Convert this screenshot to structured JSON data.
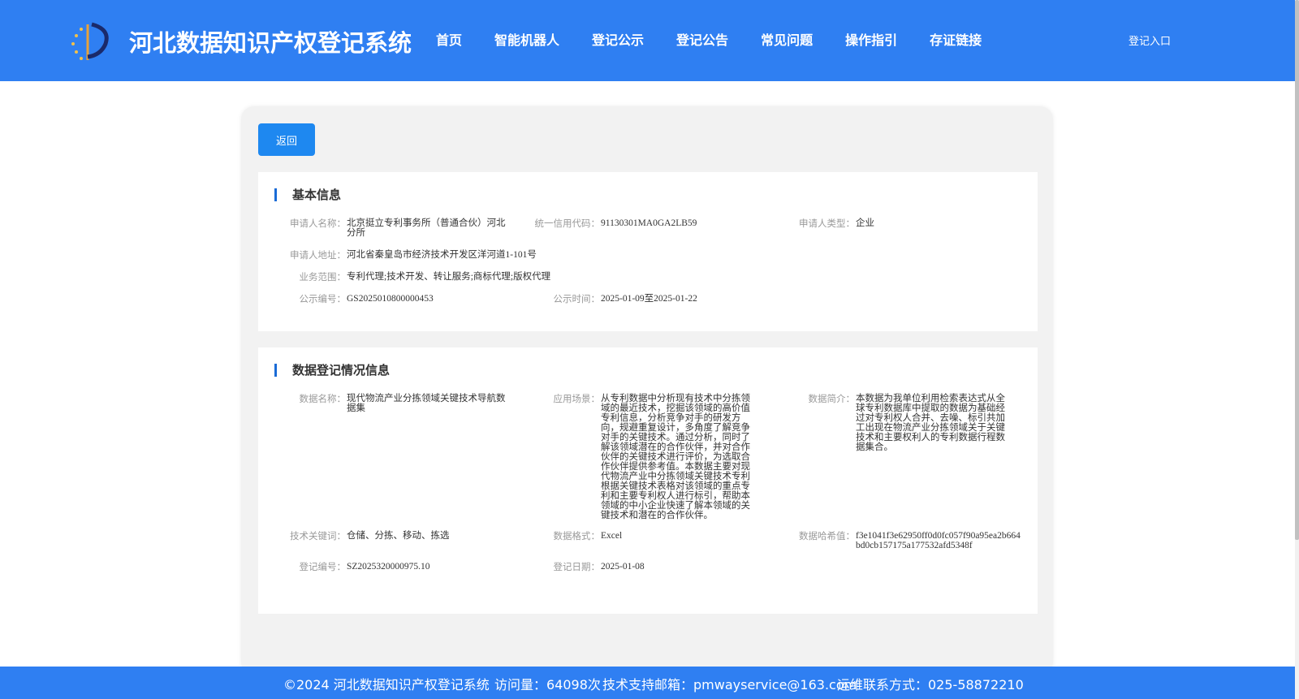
{
  "header": {
    "title": "河北数据知识产权登记系统",
    "nav": [
      "首页",
      "智能机器人",
      "登记公示",
      "登记公告",
      "常见问题",
      "操作指引",
      "存证链接"
    ],
    "login": "登记入口"
  },
  "back_button": "返回",
  "basic": {
    "title": "基本信息",
    "applicant_name_label": "申请人名称：",
    "applicant_name": "北京挺立专利事务所（普通合伙）河北分所",
    "credit_code_label": "统一信用代码：",
    "credit_code": "91130301MA0GA2LB59",
    "applicant_type_label": "申请人类型：",
    "applicant_type": "企业",
    "address_label": "申请人地址：",
    "address": "河北省秦皇岛市经济技术开发区洋河道1-101号",
    "scope_label": "业务范围：",
    "scope": "专利代理;技术开发、转让服务;商标代理;版权代理",
    "notice_no_label": "公示编号：",
    "notice_no": "GS2025010800000453",
    "notice_time_label": "公示时间：",
    "notice_time": "2025-01-09至2025-01-22"
  },
  "data_info": {
    "title": "数据登记情况信息",
    "data_name_label": "数据名称：",
    "data_name": "现代物流产业分拣领域关键技术导航数据集",
    "scenario_label": "应用场景：",
    "scenario": "从专利数据中分析现有技术中分拣领域的最近技术，挖掘该领域的高价值专利信息，分析竞争对手的研发方向，规避重复设计，多角度了解竞争对手的关键技术。通过分析，同时了解该领域潜在的合作伙伴，并对合作伙伴的关键技术进行评价，为选取合作伙伴提供参考值。本数据主要对现代物流产业中分拣领域关键技术专利根据关键技术表格对该领域的重点专利和主要专利权人进行标引，帮助本领域的中小企业快速了解本领域的关键技术和潜在的合作伙伴。",
    "intro_label": "数据简介：",
    "intro": "本数据为我单位利用检索表达式从全球专利数据库中提取的数据为基础经过对专利权人合并、去噪、标引共加工出现在物流产业分拣领域关于关键技术和主要权利人的专利数据行程数据集合。",
    "keywords_label": "技术关键词：",
    "keywords": "仓储、分拣、移动、拣选",
    "format_label": "数据格式：",
    "format": "Excel",
    "hash_label": "数据哈希值：",
    "hash": "f3e1041f3e62950ff0d0fc057f90a95ea2b664bd0cb157175a177532afd5348f",
    "reg_no_label": "登记编号：",
    "reg_no": "SZ2025320000975.10",
    "reg_date_label": "登记日期：",
    "reg_date": "2025-01-08"
  },
  "footer": {
    "copyright": "©2024 河北数据知识产权登记系统",
    "visits": "访问量：64098次",
    "email": "技术支持邮箱：pmwayservice@163.com",
    "phone": "运维联系方式：025-58872210"
  }
}
